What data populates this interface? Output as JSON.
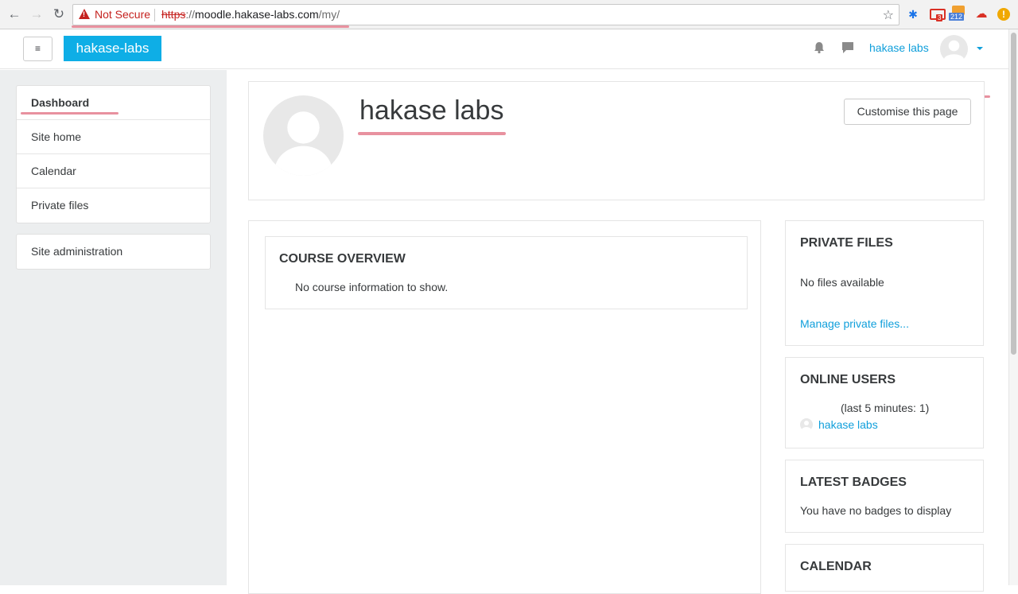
{
  "browser": {
    "security_label": "Not Secure",
    "url_scheme": "https",
    "url_sep": "://",
    "url_host": "moodle.hakase-labs.com",
    "url_path": "/my/",
    "ext_gmail_badge": "3",
    "ext_rss_badge": "212",
    "ext_bluetooth_glyph": "✱",
    "ext_cloud_glyph": "☁",
    "ext_alert_glyph": "!",
    "back_glyph": "←",
    "forward_glyph": "→",
    "reload_glyph": "↻",
    "star_glyph": "☆"
  },
  "navbar": {
    "menu_glyph": "≡",
    "brand": "hakase-labs",
    "user_name": "hakase labs"
  },
  "nav": {
    "items": [
      {
        "label": "Dashboard"
      },
      {
        "label": "Site home"
      },
      {
        "label": "Calendar"
      },
      {
        "label": "Private files"
      }
    ],
    "admin_label": "Site administration"
  },
  "header": {
    "title": "hakase labs",
    "customise_label": "Customise this page"
  },
  "course_overview": {
    "title": "COURSE OVERVIEW",
    "message": "No course information to show."
  },
  "private_files": {
    "title": "PRIVATE FILES",
    "message": "No files available",
    "link": "Manage private files..."
  },
  "online_users": {
    "title": "ONLINE USERS",
    "summary": "(last 5 minutes: 1)",
    "user": "hakase labs"
  },
  "latest_badges": {
    "title": "LATEST BADGES",
    "message": "You have no badges to display"
  },
  "calendar": {
    "title": "CALENDAR"
  },
  "colors": {
    "brand": "#0eaee6",
    "link": "#109fdb",
    "annotation": "#e8919f",
    "sidebar_bg": "#eceeef"
  }
}
